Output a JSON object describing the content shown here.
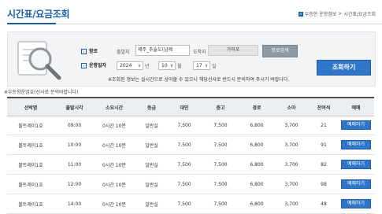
{
  "page": {
    "title": "시간표/요금조회",
    "breadcrumb": [
      "우등한 운항정보",
      "시간표/요금조회"
    ]
  },
  "search": {
    "route_label": "항로",
    "departure_label": "출발지",
    "departure_value": "제주_추술도(남제",
    "arrival_label": "도착지",
    "arrival_value": "가마포",
    "route_search_button": "항로검색",
    "date_label": "운항일자",
    "year": "2024",
    "year_unit": "년",
    "month": "10",
    "month_unit": "월",
    "day": "17",
    "day_unit": "일",
    "notice": "※조회된 정보는 실시간으로 상이할 수 있으니 해당선사로 반드시 문의하여 주시기 바랍니다.",
    "lookup_button": "조회하기"
  },
  "under_note": "※우등항운업호(선사로 문의바랍니다)",
  "table": {
    "headers": [
      "선박명",
      "출발시각",
      "소요시간",
      "등급",
      "대인",
      "중고",
      "경로",
      "소아",
      "잔여석",
      "예매"
    ],
    "rows": [
      {
        "ship": "볼트레이1호",
        "depart": "09:00",
        "duration": "0시간 10분",
        "grade": "일반실",
        "adult": "7,500",
        "youth": "7,500",
        "senior": "6,800",
        "child": "3,700",
        "seats": "21",
        "action": "예매하기"
      },
      {
        "ship": "볼트레이1호",
        "depart": "10:00",
        "duration": "0시간 10분",
        "grade": "일반실",
        "adult": "7,500",
        "youth": "7,500",
        "senior": "6,800",
        "child": "3,700",
        "seats": "91",
        "action": "예매하기"
      },
      {
        "ship": "볼트레이1호",
        "depart": "11:00",
        "duration": "0시간 10분",
        "grade": "일반실",
        "adult": "7,500",
        "youth": "7,500",
        "senior": "6,800",
        "child": "3,700",
        "seats": "82",
        "action": "예매하기"
      },
      {
        "ship": "볼트레이1호",
        "depart": "12:00",
        "duration": "0시간 10분",
        "grade": "일반실",
        "adult": "7,500",
        "youth": "7,500",
        "senior": "6,800",
        "child": "3,700",
        "seats": "98",
        "action": "예매하기"
      },
      {
        "ship": "볼트레이1호",
        "depart": "14:00",
        "duration": "0시간 10분",
        "grade": "일반실",
        "adult": "7,500",
        "youth": "7,500",
        "senior": "6,800",
        "child": "3,700",
        "seats": "48",
        "action": "예매하기"
      }
    ]
  },
  "colors": {
    "accent": "#2f76c8",
    "title": "#1a5ea8"
  }
}
